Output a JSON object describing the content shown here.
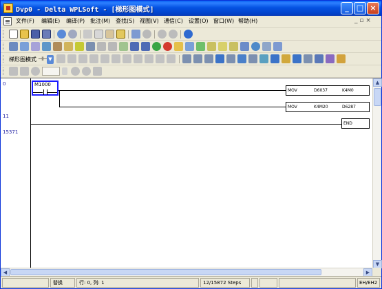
{
  "window": {
    "title": "Dvp0 - Delta WPLSoft - [梯形图模式]"
  },
  "menu": {
    "items": [
      "文件(F)",
      "编辑(E)",
      "编译(P)",
      "批注(M)",
      "查找(S)",
      "视图(V)",
      "通信(C)",
      "设置(O)",
      "窗口(W)",
      "帮助(H)"
    ],
    "mdi_controls": "_ ▫ ×"
  },
  "toolbar3": {
    "mode_label": "梯形图模式"
  },
  "ladder": {
    "line_numbers": [
      "0",
      "11",
      "15371"
    ],
    "contact_label": "M1000",
    "instructions": [
      {
        "op": "MOV",
        "arg1": "D6037",
        "arg2": "K4M0"
      },
      {
        "op": "MOV",
        "arg1": "K4M20",
        "arg2": "D6287"
      },
      {
        "op": "END",
        "arg1": "",
        "arg2": ""
      }
    ]
  },
  "status": {
    "mode": "替换",
    "position": "行: 0, 列: 1",
    "steps": "12/15872 Steps",
    "device": "EH/EH2"
  }
}
